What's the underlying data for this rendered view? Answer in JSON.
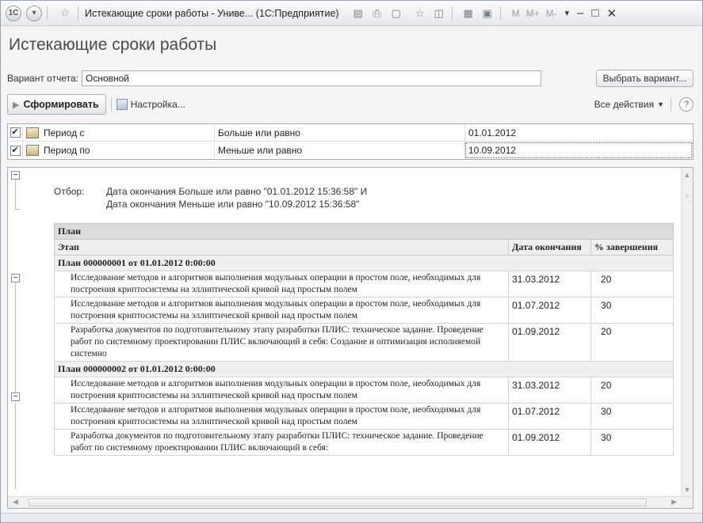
{
  "window": {
    "title": "Истекающие сроки работы - Униве... (1С:Предприятие)",
    "app_icon": "1c-logo-icon",
    "m_buttons": [
      "M",
      "M+",
      "M-"
    ]
  },
  "page_title": "Истекающие сроки работы",
  "variant": {
    "label": "Вариант отчета:",
    "value": "Основной",
    "choose_button": "Выбрать вариант..."
  },
  "toolbar": {
    "generate": "Сформировать",
    "settings": "Настройка...",
    "all_actions": "Все действия",
    "help": "?"
  },
  "settings": [
    {
      "checked": true,
      "name": "Период с",
      "condition": "Больше или равно",
      "value": "01.01.2012"
    },
    {
      "checked": true,
      "name": "Период по",
      "condition": "Меньше или равно",
      "value": "10.09.2012"
    }
  ],
  "report": {
    "filter_label": "Отбор:",
    "filter_line1": "Дата окончания Больше или равно \"01.01.2012 15:36:58\" И",
    "filter_line2": "Дата окончания Меньше или равно \"10.09.2012 15:36:58\"",
    "header_plan": "План",
    "col_stage": "Этап",
    "col_date": "Дата окончания",
    "col_percent": "% завершения",
    "groups": [
      {
        "title": "План 000000001 от 01.01.2012 0:00:00",
        "rows": [
          {
            "stage": "Исследование методов и алгоритмов выполнения модульных операции в простом поле, необходимых для построения криптосистемы на эллиптической кривой над простым полем",
            "date": "31.03.2012",
            "percent": "20"
          },
          {
            "stage": "Исследование методов и алгоритмов выполнения модульных операции в простом поле, необходимых для построения криптосистемы на эллиптической кривой над простым полем",
            "date": "01.07.2012",
            "percent": "30"
          },
          {
            "stage": "Разработка документов по подготовительному этапу разработки ПЛИС: техническое задание. Проведение работ по системному проектировании ПЛИС включающий в себя: Создание и оптимизация исполняемой системно",
            "date": "01.09.2012",
            "percent": "20"
          }
        ]
      },
      {
        "title": "План 000000002 от 01.01.2012 0:00:00",
        "rows": [
          {
            "stage": "Исследование методов и алгоритмов выполнения модульных операции в простом поле, необходимых для построения криптосистемы на эллиптической кривой над простым полем",
            "date": "31.03.2012",
            "percent": "20"
          },
          {
            "stage": "Исследование методов и алгоритмов выполнения модульных операции в простом поле, необходимых для построения криптосистемы на эллиптической кривой над простым полем",
            "date": "01.07.2012",
            "percent": "30"
          },
          {
            "stage": "Разработка документов по подготовительному этапу разработки ПЛИС: техническое задание. Проведение работ по системному проектировании ПЛИС включающий в себя:",
            "date": "01.09.2012",
            "percent": "30"
          }
        ]
      }
    ]
  }
}
